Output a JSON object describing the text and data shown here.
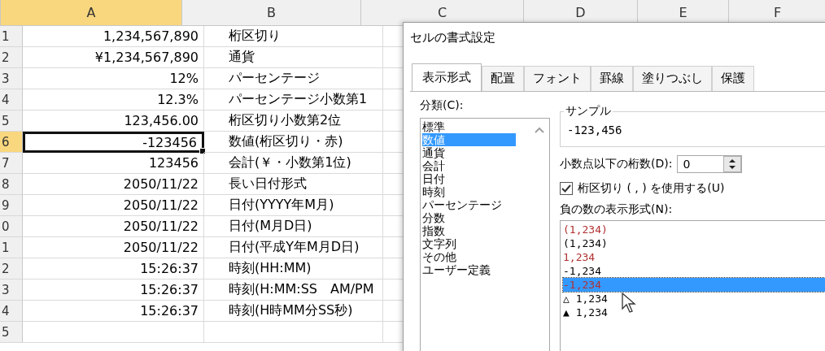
{
  "sheet": {
    "columns": [
      {
        "label": "A",
        "selected": true
      },
      {
        "label": "B",
        "selected": false
      },
      {
        "label": "C",
        "selected": false
      },
      {
        "label": "D",
        "selected": false
      },
      {
        "label": "E",
        "selected": false
      },
      {
        "label": "F",
        "selected": false
      }
    ],
    "rows": [
      {
        "header": "1",
        "selected": false,
        "cells": [
          "1,234,567,890",
          "桁区切り"
        ]
      },
      {
        "header": "2",
        "selected": false,
        "cells": [
          "¥1,234,567,890",
          "通貨"
        ]
      },
      {
        "header": "3",
        "selected": false,
        "cells": [
          "12%",
          "パーセンテージ"
        ]
      },
      {
        "header": "4",
        "selected": false,
        "cells": [
          "12.3%",
          "パーセンテージ小数第1"
        ]
      },
      {
        "header": "5",
        "selected": false,
        "cells": [
          "123,456.00",
          "桁区切り小数第2位"
        ]
      },
      {
        "header": "6",
        "selected": true,
        "cells": [
          "-123456",
          "数値(桁区切り・赤)"
        ]
      },
      {
        "header": "7",
        "selected": false,
        "cells": [
          "123456",
          "会計(￥・小数第1位)"
        ]
      },
      {
        "header": "8",
        "selected": false,
        "cells": [
          "2050/11/22",
          "長い日付形式"
        ]
      },
      {
        "header": "9",
        "selected": false,
        "cells": [
          "2050/11/22",
          "日付(YYYY年M月)"
        ]
      },
      {
        "header": "0",
        "selected": false,
        "cells": [
          "2050/11/22",
          "日付(M月D日)"
        ]
      },
      {
        "header": "1",
        "selected": false,
        "cells": [
          "2050/11/22",
          "日付(平成Y年M月D日)"
        ]
      },
      {
        "header": "2",
        "selected": false,
        "cells": [
          "15:26:37",
          "時刻(HH:MM)"
        ]
      },
      {
        "header": "3",
        "selected": false,
        "cells": [
          "15:26:37",
          "時刻(H:MM:SS　AM/PM"
        ]
      },
      {
        "header": "4",
        "selected": false,
        "cells": [
          "15:26:37",
          "時刻(H時MM分SS秒)"
        ]
      },
      {
        "header": "5",
        "selected": false,
        "cells": [
          "",
          ""
        ]
      }
    ]
  },
  "dialog": {
    "title": "セルの書式設定",
    "tabs": [
      {
        "label": "表示形式",
        "selected": true
      },
      {
        "label": "配置",
        "selected": false
      },
      {
        "label": "フォント",
        "selected": false
      },
      {
        "label": "罫線",
        "selected": false
      },
      {
        "label": "塗りつぶし",
        "selected": false
      },
      {
        "label": "保護",
        "selected": false
      }
    ],
    "category_label": "分類(C):",
    "categories": [
      {
        "label": "標準",
        "selected": false
      },
      {
        "label": "数値",
        "selected": true
      },
      {
        "label": "通貨",
        "selected": false
      },
      {
        "label": "会計",
        "selected": false
      },
      {
        "label": "日付",
        "selected": false
      },
      {
        "label": "時刻",
        "selected": false
      },
      {
        "label": "パーセンテージ",
        "selected": false
      },
      {
        "label": "分数",
        "selected": false
      },
      {
        "label": "指数",
        "selected": false
      },
      {
        "label": "文字列",
        "selected": false
      },
      {
        "label": "その他",
        "selected": false
      },
      {
        "label": "ユーザー定義",
        "selected": false
      }
    ],
    "sample": {
      "label": "サンプル",
      "value": "-123,456"
    },
    "decimals": {
      "label": "小数点以下の桁数(D):",
      "value": "0"
    },
    "separator": {
      "label": "桁区切り ( , ) を使用する(U)",
      "checked": true
    },
    "negative_label": "負の数の表示形式(N):",
    "negative_formats": [
      {
        "label": "(1,234)",
        "color": "#b03030",
        "selected": false
      },
      {
        "label": "(1,234)",
        "color": "#000000",
        "selected": false
      },
      {
        "label": "1,234",
        "color": "#b03030",
        "selected": false
      },
      {
        "label": "-1,234",
        "color": "#000000",
        "selected": false
      },
      {
        "label": "-1,234",
        "color": "#b03030",
        "selected": true
      },
      {
        "label": "△ 1,234",
        "color": "#000000",
        "selected": false
      },
      {
        "label": "▲ 1,234",
        "color": "#000000",
        "selected": false
      }
    ]
  }
}
